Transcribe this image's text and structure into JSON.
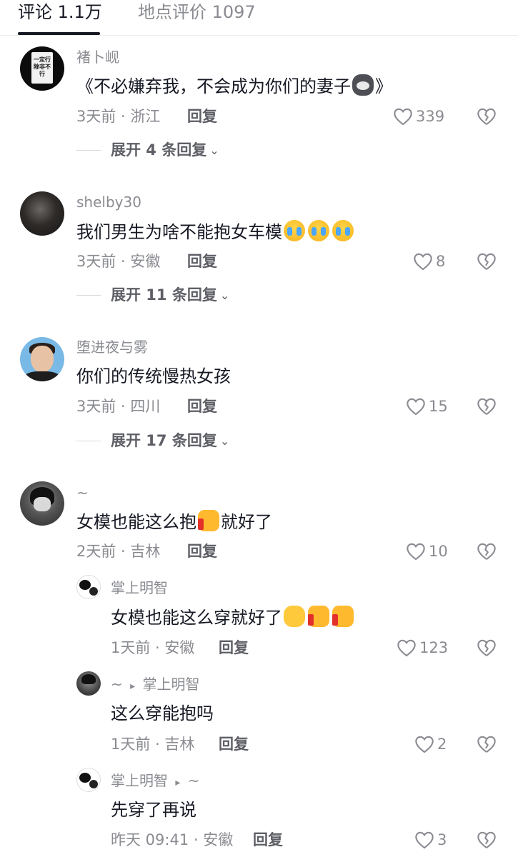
{
  "tabs": {
    "comments": "评论 1.1万",
    "location_reviews": "地点评价 1097"
  },
  "comments": [
    {
      "user": "褚卜岘",
      "avatar_book_text": "一定行 除非不行",
      "text_before": "《不必嫌弃我，不会成为你们的妻子",
      "text_after": "》",
      "emojis": [
        "dog-face"
      ],
      "meta": "3天前 · 浙江",
      "reply": "回复",
      "likes": "339",
      "expand": "展开 4 条回复"
    },
    {
      "user": "shelby30",
      "text_before": "我们男生为啥不能抱女车模",
      "emojis": [
        "crying-face",
        "crying-face",
        "crying-face"
      ],
      "meta": "3天前 · 安徽",
      "reply": "回复",
      "likes": "8",
      "expand": "展开 11 条回复"
    },
    {
      "user": "堕进夜与雾",
      "text_before": "你们的传统慢热女孩",
      "meta": "3天前 · 四川",
      "reply": "回复",
      "likes": "15",
      "expand": "展开 17 条回复"
    },
    {
      "user": "~",
      "text_before": "女模也能这么抱",
      "text_after": "就好了",
      "emojis": [
        "thumbs-up"
      ],
      "meta": "2天前 · 吉林",
      "reply": "回复",
      "likes": "10",
      "replies": [
        {
          "user": "掌上明智",
          "text_before": "女模也能这么穿就好了",
          "emojis": [
            "clapping-hands",
            "thumbs-up",
            "thumbs-up"
          ],
          "meta": "1天前 · 安徽",
          "reply": "回复",
          "likes": "123"
        },
        {
          "user": "~",
          "reply_to_arrow": "▸",
          "reply_to": "掌上明智",
          "text_before": "这么穿能抱吗",
          "meta": "1天前 · 吉林",
          "reply": "回复",
          "likes": "2"
        },
        {
          "user": "掌上明智",
          "reply_to_arrow": "▸",
          "reply_to": "~",
          "text_before": "先穿了再说",
          "meta": "昨天 09:41 · 安徽",
          "reply": "回复",
          "likes": "3"
        }
      ]
    }
  ],
  "colors": {
    "primary_text": "#161823",
    "secondary_text": "#8a8b91",
    "divider": "#ececec"
  }
}
